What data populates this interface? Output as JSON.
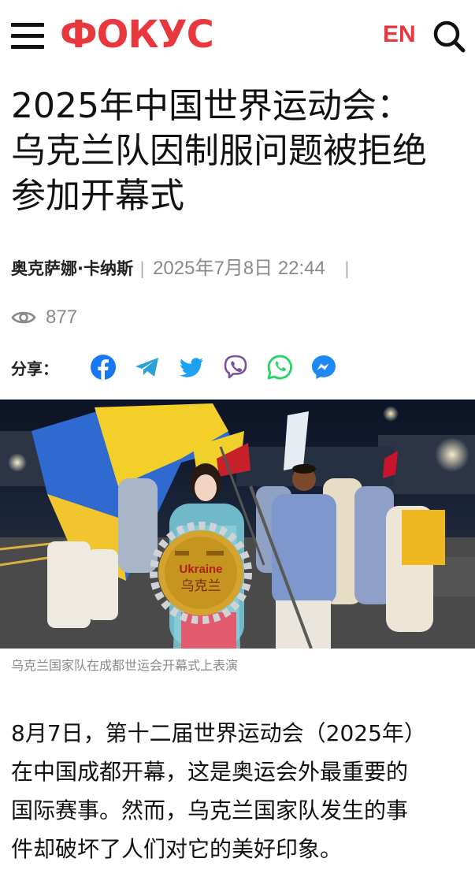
{
  "header": {
    "logo": "ФОКУС",
    "lang": "EN",
    "menu_icon": "hamburger-menu-icon",
    "search_icon": "search-icon",
    "accent_color": "#e8383d"
  },
  "article": {
    "title_lines": [
      "2025年中国世界运动会：",
      "乌克兰队因制服问题被拒绝",
      "参加开幕式"
    ],
    "author": "奥克萨娜·卡纳斯",
    "date": "2025年7月8日 22:44",
    "views": "877",
    "share_label": "分享：",
    "share_icons": [
      "facebook-icon",
      "telegram-icon",
      "twitter-icon",
      "viber-icon",
      "whatsapp-icon",
      "messenger-icon"
    ],
    "photo": {
      "sign_text": "Ukraine",
      "sign_text_cn": "乌克兰"
    },
    "caption": "乌克兰国家队在成都世运会开幕式上表演",
    "body_lines": [
      "8月7日，第十二届世界运动会（2025年）",
      "在中国成都开幕，这是奥运会外最重要的",
      "国际赛事。然而，乌克兰国家队发生的事",
      "件却破坏了人们对它的美好印象。"
    ]
  }
}
